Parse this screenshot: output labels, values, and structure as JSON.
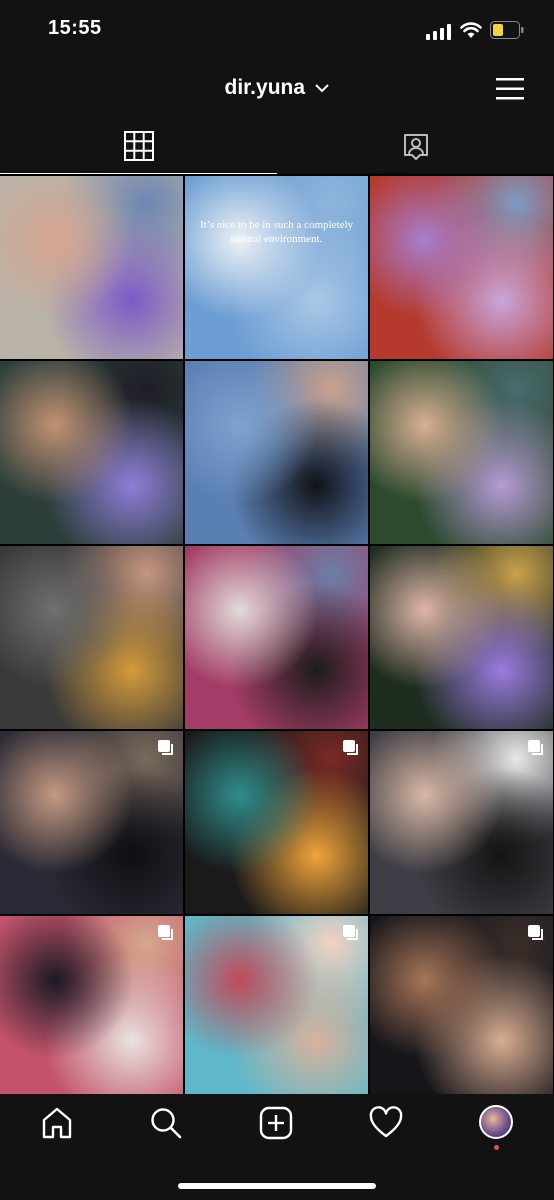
{
  "status_bar": {
    "time": "15:55"
  },
  "header": {
    "username": "dir.yuna"
  },
  "tabs": {
    "active": "grid"
  },
  "posts": [
    {
      "caption": "",
      "multi": false,
      "colors": [
        "#b9b3a7",
        "#7b5bc8",
        "#d6a48f",
        "#6d86b2"
      ]
    },
    {
      "caption": "It’s nice to be in such a completely natural environment.",
      "multi": false,
      "colors": [
        "#6d9ed3",
        "#a9c8e6",
        "#eef2f6",
        "#8fb6dc"
      ]
    },
    {
      "caption": "",
      "multi": false,
      "colors": [
        "#b5392d",
        "#c9a6dc",
        "#a77fcf",
        "#7d9bc3"
      ]
    },
    {
      "caption": "",
      "multi": false,
      "colors": [
        "#2b3e3a",
        "#8f7dd8",
        "#c39274",
        "#1e1e26"
      ]
    },
    {
      "caption": "",
      "multi": false,
      "colors": [
        "#5a7fb3",
        "#121218",
        "#7fa3cf",
        "#caa18b"
      ]
    },
    {
      "caption": "",
      "multi": false,
      "colors": [
        "#2c4a2e",
        "#b69bd6",
        "#d9b095",
        "#4a6a6f"
      ]
    },
    {
      "caption": "",
      "multi": false,
      "colors": [
        "#3a3a3a",
        "#d49b3b",
        "#707070",
        "#c79680"
      ]
    },
    {
      "caption": "",
      "multi": false,
      "colors": [
        "#a33c66",
        "#1c1c1c",
        "#e0dcd8",
        "#6a7fa8"
      ]
    },
    {
      "caption": "",
      "multi": false,
      "colors": [
        "#1f2d20",
        "#9a7be0",
        "#e0b7a8",
        "#c9a14e"
      ]
    },
    {
      "caption": "",
      "multi": true,
      "colors": [
        "#2a2a36",
        "#0f0f12",
        "#c59a82",
        "#7a6a5a"
      ]
    },
    {
      "caption": "",
      "multi": true,
      "colors": [
        "#1a1a1a",
        "#f0a43a",
        "#2f8e8c",
        "#7a2a24"
      ]
    },
    {
      "caption": "",
      "multi": true,
      "colors": [
        "#3e3e46",
        "#141414",
        "#d9b8a4",
        "#e8e8e8"
      ]
    },
    {
      "caption": "",
      "multi": true,
      "colors": [
        "#c4536b",
        "#e8e4e0",
        "#1a1a24",
        "#d5a88e"
      ]
    },
    {
      "caption": "",
      "multi": true,
      "colors": [
        "#5eb8c9",
        "#d9b29c",
        "#c24a58",
        "#f3d2c2"
      ]
    },
    {
      "caption": "",
      "multi": true,
      "colors": [
        "#15151a",
        "#d9ad92",
        "#a87658",
        "#3a2e2a"
      ]
    }
  ],
  "nav": {
    "items": [
      "home-icon",
      "search-icon",
      "new-post-icon",
      "activity-heart-icon",
      "profile-avatar"
    ]
  }
}
